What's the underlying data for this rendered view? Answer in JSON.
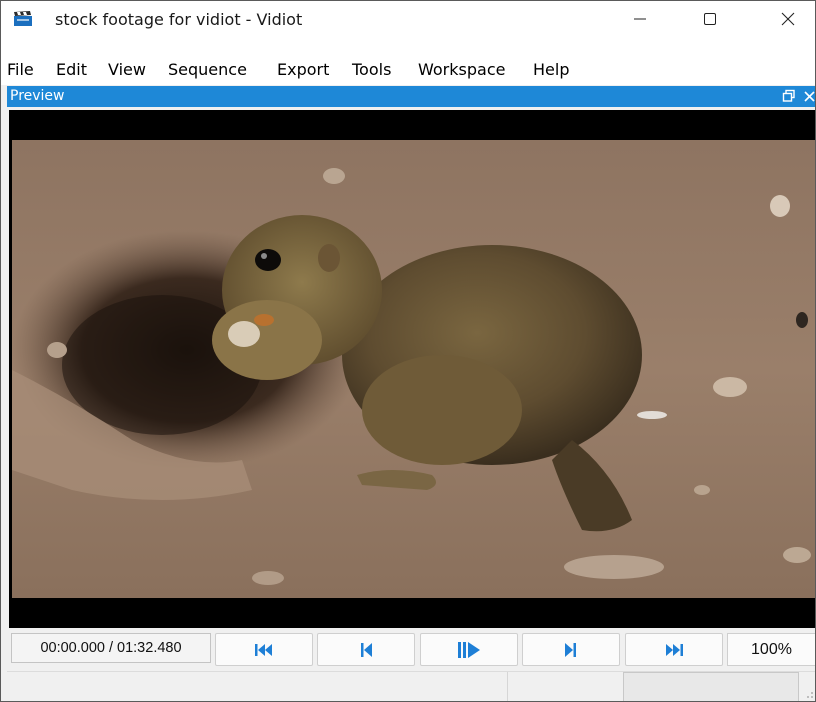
{
  "window": {
    "title": "stock footage for vidiot - Vidiot",
    "controls": [
      "minimize",
      "maximize",
      "close"
    ]
  },
  "menu": [
    "File",
    "Edit",
    "View",
    "Sequence",
    "Export",
    "Tools",
    "Workspace",
    "Help"
  ],
  "panel": {
    "title": "Preview",
    "icons": [
      "restore-icon",
      "close-icon"
    ]
  },
  "transport": {
    "timecode": "00:00.000 / 01:32.480",
    "buttons": [
      "go-to-start",
      "previous-frame",
      "play-pause",
      "next-frame",
      "go-to-end"
    ],
    "zoom": "100%"
  },
  "colors": {
    "caption": "#1e88d7",
    "transport_icon": "#1e7fd6",
    "chrome": "#f0f0f0"
  }
}
